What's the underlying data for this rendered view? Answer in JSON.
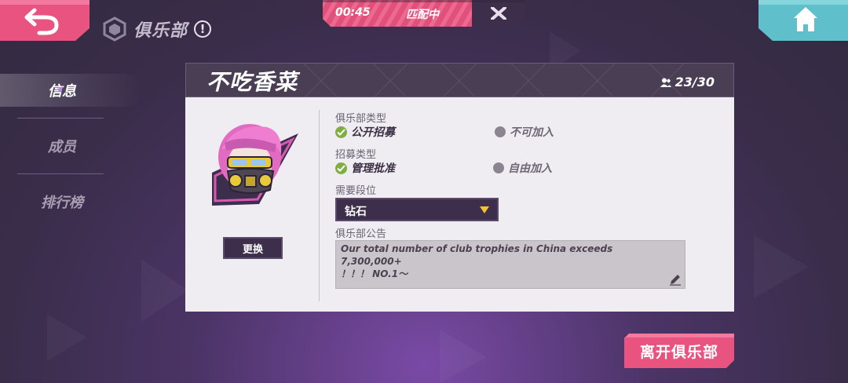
{
  "header": {
    "title": "俱乐部",
    "info_glyph": "!",
    "back_icon": "back-arrow-icon",
    "home_icon": "home-icon"
  },
  "match": {
    "time": "00:45",
    "status": "匹配中",
    "close_glyph": "✕"
  },
  "nav": {
    "items": [
      {
        "label": "信息",
        "active": true
      },
      {
        "label": "成员",
        "active": false
      },
      {
        "label": "排行榜",
        "active": false
      }
    ]
  },
  "club": {
    "name": "不吃香菜",
    "member_count": "23/30",
    "change_avatar_label": "更换",
    "club_type_label": "俱乐部类型",
    "club_type_options": [
      {
        "label": "公开招募",
        "selected": true
      },
      {
        "label": "不可加入",
        "selected": false
      }
    ],
    "recruit_type_label": "招募类型",
    "recruit_type_options": [
      {
        "label": "管理批准",
        "selected": true
      },
      {
        "label": "自由加入",
        "selected": false
      }
    ],
    "rank_label": "需要段位",
    "rank_value": "钻石",
    "notice_label": "俱乐部公告",
    "notice_text": "Our total number of club trophies in China exceeds 7,300,000+\n！！！ NO.1～"
  },
  "leave_button": "离开俱乐部",
  "colors": {
    "accent_pink": "#e8547f",
    "accent_teal": "#5fbfca",
    "check_green": "#7fae41",
    "arrow_yellow": "#f2c230"
  }
}
